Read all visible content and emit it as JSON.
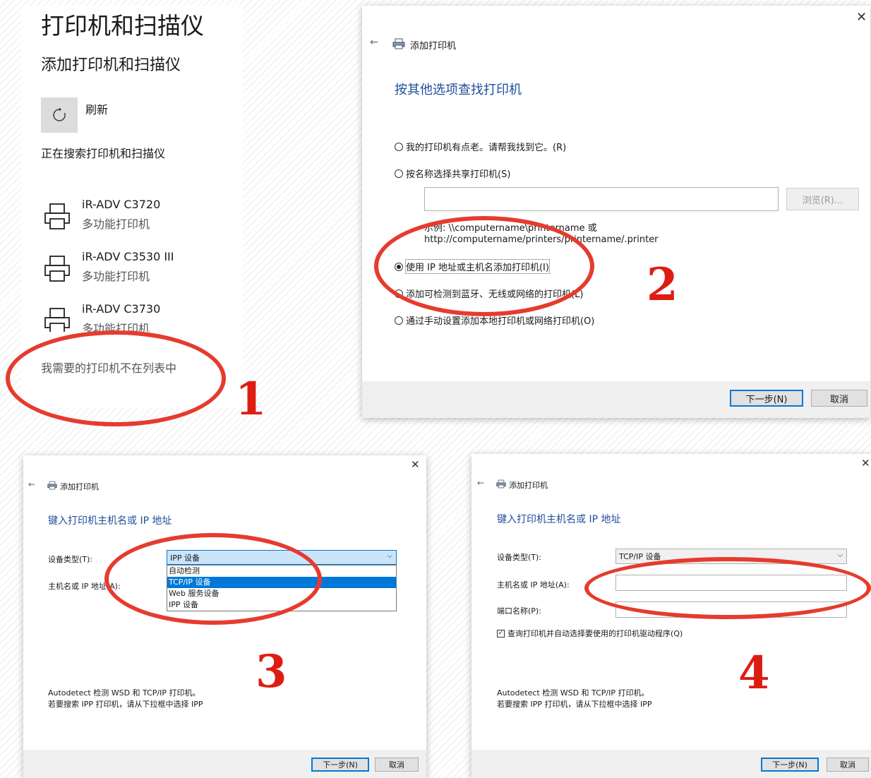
{
  "colors": {
    "accent": "#0078d7",
    "title_blue": "#1f4e9c",
    "annotation_red": "#e63b2e"
  },
  "step1": {
    "title": "打印机和扫描仪",
    "subtitle": "添加打印机和扫描仪",
    "refresh_label": "刷新",
    "searching_text": "正在搜索打印机和扫描仪",
    "printers": [
      {
        "name": "iR-ADV C3720",
        "type": "多功能打印机"
      },
      {
        "name": "iR-ADV C3530 III",
        "type": "多功能打印机"
      },
      {
        "name": "iR-ADV C3730",
        "type": "多功能打印机"
      }
    ],
    "not_listed_link": "我需要的打印机不在列表中",
    "step_number": "1"
  },
  "step2": {
    "header": "添加打印机",
    "title": "按其他选项查找打印机",
    "options": [
      "我的打印机有点老。请帮我找到它。(R)",
      "按名称选择共享打印机(S)",
      "使用 IP 地址或主机名添加打印机(I)",
      "添加可检测到蓝牙、无线或网络的打印机(L)",
      "通过手动设置添加本地打印机或网络打印机(O)"
    ],
    "selected_option": "使用 IP 地址或主机名添加打印机(I)",
    "browse_label": "浏览(R)...",
    "example_line1": "示例: \\\\computername\\printername 或",
    "example_line2": "http://computername/printers/printername/.printer",
    "next_label": "下一步(N)",
    "cancel_label": "取消",
    "step_number": "2"
  },
  "step3": {
    "header": "添加打印机",
    "title": "键入打印机主机名或 IP 地址",
    "device_type_label": "设备类型(T):",
    "device_type_value": "IPP 设备",
    "dropdown_options": [
      "自动检测",
      "TCP/IP 设备",
      "Web 服务设备",
      "IPP 设备"
    ],
    "dropdown_highlighted": "TCP/IP 设备",
    "host_label": "主机名或 IP 地址(A):",
    "help_line1": "Autodetect 检测 WSD 和 TCP/IP 打印机。",
    "help_line2": "若要搜索 IPP 打印机，请从下拉框中选择 IPP",
    "next_label": "下一步(N)",
    "cancel_label": "取消",
    "step_number": "3"
  },
  "step4": {
    "header": "添加打印机",
    "title": "键入打印机主机名或 IP 地址",
    "device_type_label": "设备类型(T):",
    "device_type_value": "TCP/IP 设备",
    "host_label": "主机名或 IP 地址(A):",
    "host_value": "",
    "port_label": "端口名称(P):",
    "port_value": "",
    "query_checkbox_label": "查询打印机并自动选择要使用的打印机驱动程序(Q)",
    "query_checked": true,
    "help_line1": "Autodetect 检测 WSD 和 TCP/IP 打印机。",
    "help_line2": "若要搜索 IPP 打印机，请从下拉框中选择 IPP",
    "next_label": "下一步(N)",
    "cancel_label": "取消",
    "step_number": "4"
  }
}
